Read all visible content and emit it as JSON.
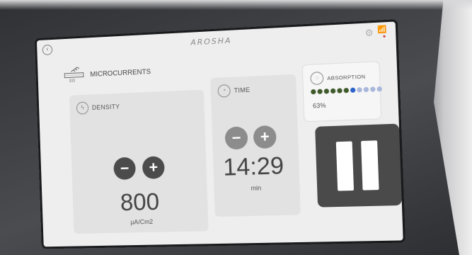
{
  "header": {
    "brand": "AROSHA",
    "back_icon": "back-arrow-icon",
    "settings_icon": "gear-icon",
    "wifi_icon": "wifi-icon",
    "status_color": "#d23b3b"
  },
  "mode": {
    "label": "MICROCURRENTS",
    "icon": "microcurrents-icon"
  },
  "density": {
    "label": "DENSITY",
    "icon": "density-icon",
    "minus": "−",
    "plus": "+",
    "value": "800",
    "unit": "µA/Cm2"
  },
  "time": {
    "label": "TIME",
    "icon": "timer-icon",
    "minus": "−",
    "plus": "+",
    "value": "14:29",
    "unit": "min"
  },
  "absorption": {
    "label": "ABSORPTION",
    "icon": "absorption-icon",
    "percent": "63%",
    "level": 0.63,
    "filled_color": "#3f5a2a",
    "active_color": "#2b63c9",
    "empty_color": "#a9b7db"
  },
  "pause": {
    "icon": "pause-icon"
  }
}
